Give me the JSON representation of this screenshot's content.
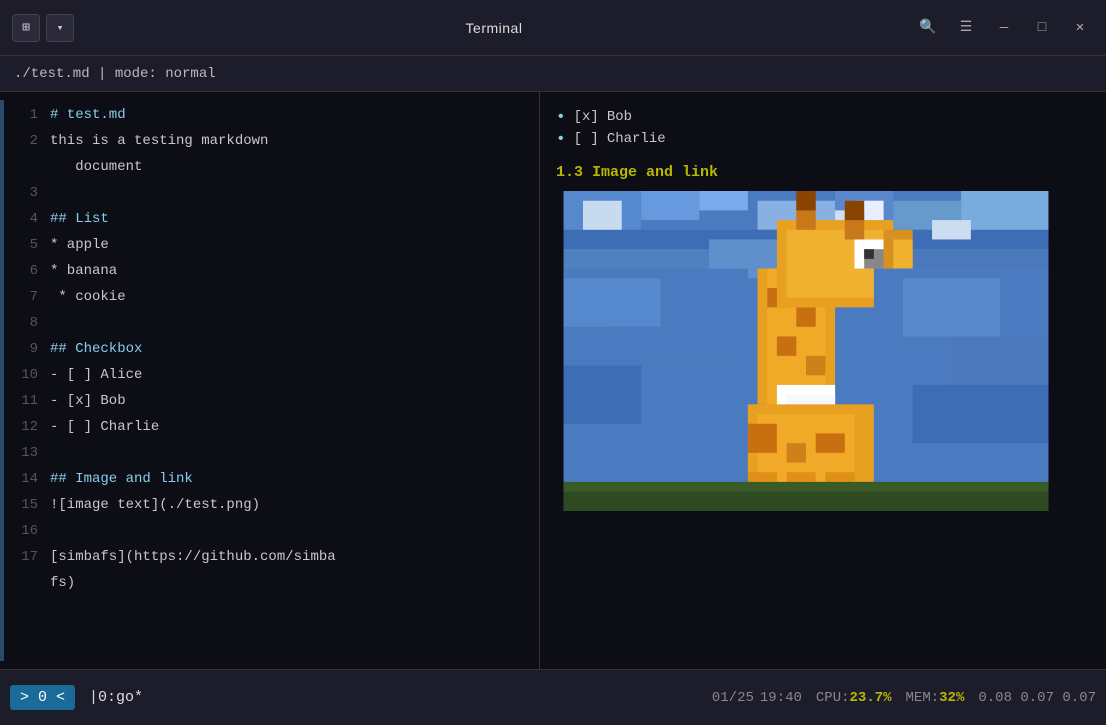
{
  "titlebar": {
    "title": "Terminal",
    "pin_label": "⊞",
    "dropdown_label": "▾",
    "search_label": "🔍",
    "menu_label": "☰",
    "minimize_label": "—",
    "maximize_label": "□",
    "close_label": "✕"
  },
  "modebar": {
    "text": "./test.md | mode: normal"
  },
  "editor": {
    "lines": [
      {
        "num": "1",
        "content": "# test.md"
      },
      {
        "num": "2",
        "content": "this is a testing markdown"
      },
      {
        "num": "",
        "content": "   document"
      },
      {
        "num": "3",
        "content": ""
      },
      {
        "num": "4",
        "content": "## List"
      },
      {
        "num": "5",
        "content": "* apple"
      },
      {
        "num": "6",
        "content": "* banana"
      },
      {
        "num": "7",
        "content": " * cookie"
      },
      {
        "num": "8",
        "content": ""
      },
      {
        "num": "9",
        "content": "## Checkbox"
      },
      {
        "num": "10",
        "content": "- [ ] Alice"
      },
      {
        "num": "11",
        "content": "- [x] Bob"
      },
      {
        "num": "12",
        "content": "- [ ] Charlie"
      },
      {
        "num": "13",
        "content": ""
      },
      {
        "num": "14",
        "content": "## Image and link"
      },
      {
        "num": "15",
        "content": "![image text](./test.png)"
      },
      {
        "num": "16",
        "content": ""
      },
      {
        "num": "17",
        "content": "[simbafs](https://github.com/simba"
      },
      {
        "num": "",
        "content": "fs)"
      }
    ]
  },
  "preview": {
    "items": [
      {
        "checked": true,
        "label": "Bob"
      },
      {
        "checked": false,
        "label": "Charlie"
      }
    ],
    "heading": "1.3 Image and link"
  },
  "statusbar": {
    "nav": "> 0 <",
    "tab": "|0:go*",
    "date": "01/25",
    "time": "19:40",
    "cpu_label": "CPU:",
    "cpu_val": "23.7%",
    "mem_label": "MEM:",
    "mem_val": "32%",
    "load1": "0.08",
    "load2": "0.07",
    "load3": "0.07"
  }
}
